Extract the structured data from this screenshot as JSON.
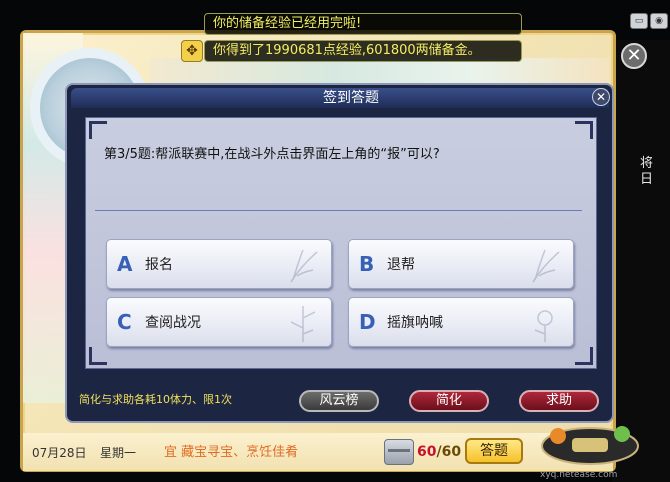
{
  "system_messages": {
    "reserve_exp_used": "你的储备经验已经用完啦!",
    "reward_notice": "你得到了1990681点经验,601800两储备金。"
  },
  "dialog": {
    "title": "签到答题",
    "question": "第3/5题:帮派联赛中,在战斗外点击界面左上角的“报”可以?",
    "answers": [
      {
        "letter": "A",
        "text": "报名"
      },
      {
        "letter": "B",
        "text": "退帮"
      },
      {
        "letter": "C",
        "text": "查阅战况"
      },
      {
        "letter": "D",
        "text": "摇旗呐喊"
      }
    ],
    "cost_note": "简化与求助各耗10体力、限1次",
    "buttons": {
      "rank": "风云榜",
      "simplify": "简化",
      "help": "求助"
    }
  },
  "bottom_bar": {
    "date": "07月28日",
    "weekday": "星期一",
    "fortune": "宜 藏宝寻宝、烹饪佳肴",
    "counter_current": "60",
    "counter_separator": "/",
    "counter_max": "60",
    "answer_button": "答题"
  },
  "logo": {
    "url_text": "xyq.netease.com"
  },
  "right_strip_chars": [
    "将",
    "日"
  ],
  "colors": {
    "accent_blue": "#3860b8",
    "message_yellow": "#f4ee62",
    "fortune_orange": "#e06b22",
    "counter_red": "#c8102e"
  }
}
